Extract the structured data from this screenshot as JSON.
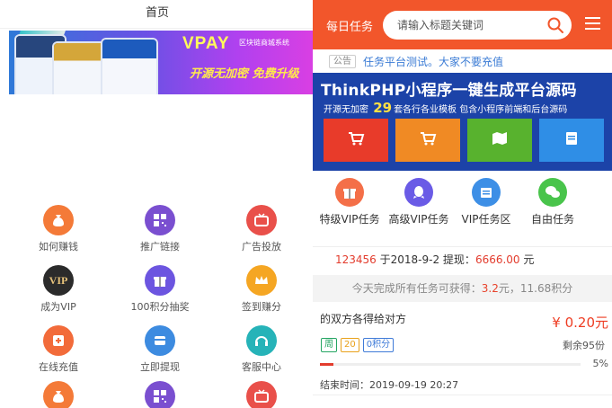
{
  "left": {
    "title": "首页",
    "banner": {
      "brand": "VPAY",
      "brand_sub": "区块链商城系统",
      "slogan": "开源无加密 免费升级"
    },
    "grid": [
      {
        "label": "如何赚钱",
        "icon": "money-bag-icon",
        "color": "#f47a38"
      },
      {
        "label": "推广链接",
        "icon": "qr-code-icon",
        "color": "#7a4fd0"
      },
      {
        "label": "广告投放",
        "icon": "tv-icon",
        "color": "#e9504a"
      },
      {
        "label": "成为VIP",
        "icon": "vip-icon",
        "color": "#2b2b2b"
      },
      {
        "label": "100积分抽奖",
        "icon": "gift-icon",
        "color": "#6c55e0"
      },
      {
        "label": "签到赚分",
        "icon": "crown-icon",
        "color": "#f5a623"
      },
      {
        "label": "在线充值",
        "icon": "recharge-icon",
        "color": "#f26b3a"
      },
      {
        "label": "立即提现",
        "icon": "withdraw-icon",
        "color": "#3d8be0"
      },
      {
        "label": "客服中心",
        "icon": "headset-icon",
        "color": "#26b3b8"
      },
      {
        "label": "",
        "icon": "money-bag-icon",
        "color": "#f47a38"
      },
      {
        "label": "",
        "icon": "qr-code-icon",
        "color": "#7a4fd0"
      },
      {
        "label": "",
        "icon": "tv-icon",
        "color": "#e9504a"
      }
    ]
  },
  "right": {
    "header": {
      "title": "每日任务",
      "search_placeholder": "请输入标题关键词",
      "accent": "#f2562b"
    },
    "notice": {
      "tag": "公告",
      "message": "任务平台测试。大家不要充值"
    },
    "promo": {
      "headline": "ThinkPHP小程序一键生成平台源码",
      "sub_before": "开源无加密",
      "sub_number": "29",
      "sub_after": "套各行各业模板  包含小程序前端和后台源码",
      "tiles": [
        {
          "color": "#e83b2a",
          "icon": "cart-icon"
        },
        {
          "color": "#f08a24",
          "icon": "cart-icon"
        },
        {
          "color": "#58b22e",
          "icon": "map-icon"
        },
        {
          "color": "#2f8ee6",
          "icon": "document-icon"
        }
      ]
    },
    "categories": [
      {
        "label": "特级VIP任务",
        "icon": "gift-icon",
        "color": "#f46f48"
      },
      {
        "label": "高级VIP任务",
        "icon": "qq-icon",
        "color": "#6a5be6"
      },
      {
        "label": "VIP任务区",
        "icon": "calendar-icon",
        "color": "#3d8fe6"
      },
      {
        "label": "自由任务",
        "icon": "wechat-icon",
        "color": "#49c44b"
      }
    ],
    "withdraw": {
      "user": "123456",
      "text1": "于2018-9-2 提现：",
      "amount": "6666.00",
      "unit": "元"
    },
    "summary": {
      "prefix": "今天完成所有任务可获得：",
      "money": "3.2",
      "money_unit": "元，",
      "points": "11.68",
      "points_unit": "积分"
    },
    "task": {
      "name": "的双方各得给对方",
      "price": "¥ 0.20元",
      "badges": [
        "周",
        "20",
        "0积分"
      ],
      "remaining": "剩余95份",
      "progress_pct": 5,
      "progress_text": "5%",
      "end_time": "结束时间：2019-09-19 20:27"
    }
  }
}
